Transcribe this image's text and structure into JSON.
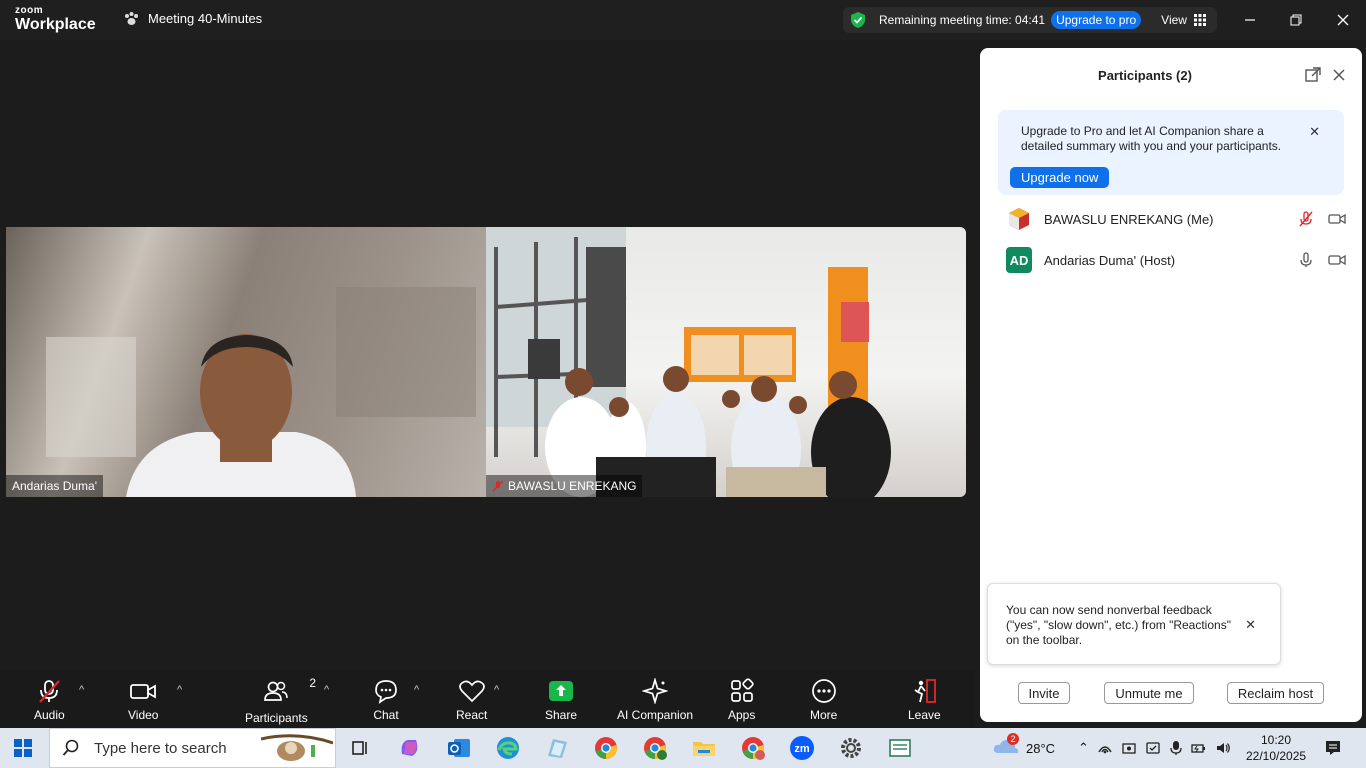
{
  "app": {
    "logo_top": "zoom",
    "logo_bottom": "Workplace",
    "meeting_name": "Meeting 40-Minutes",
    "timer_text": "Remaining meeting time: 04:41",
    "upgrade_label": "Upgrade to pro",
    "view_label": "View"
  },
  "tiles": [
    {
      "name": "Andarias Duma'"
    },
    {
      "name": "BAWASLU ENREKANG"
    }
  ],
  "toolbar": {
    "audio": "Audio",
    "video": "Video",
    "participants": "Participants",
    "participants_count": "2",
    "chat": "Chat",
    "react": "React",
    "share": "Share",
    "ai": "AI Companion",
    "apps": "Apps",
    "more": "More",
    "leave": "Leave"
  },
  "panel": {
    "title": "Participants (2)",
    "promo_text": "Upgrade to Pro and let AI Companion share a detailed summary with you and your participants.",
    "promo_button": "Upgrade now",
    "participants": [
      {
        "name": "BAWASLU ENREKANG (Me)",
        "initials": "",
        "muted": true
      },
      {
        "name": "Andarias Duma' (Host)",
        "initials": "AD",
        "muted": false
      }
    ],
    "tooltip_text": "You can now send nonverbal feedback (\"yes\", \"slow down\", etc.) from \"Reactions\" on the toolbar.",
    "invite": "Invite",
    "unmute": "Unmute me",
    "reclaim": "Reclaim host"
  },
  "taskbar": {
    "search_placeholder": "Type here to search",
    "weather_badge": "2",
    "temperature": "28°C",
    "time": "10:20",
    "date": "22/10/2025"
  },
  "colors": {
    "accent": "#0e71eb",
    "share_green": "#1ab54b",
    "leave_red": "#e02828",
    "avatar_green": "#0f8a5f"
  }
}
